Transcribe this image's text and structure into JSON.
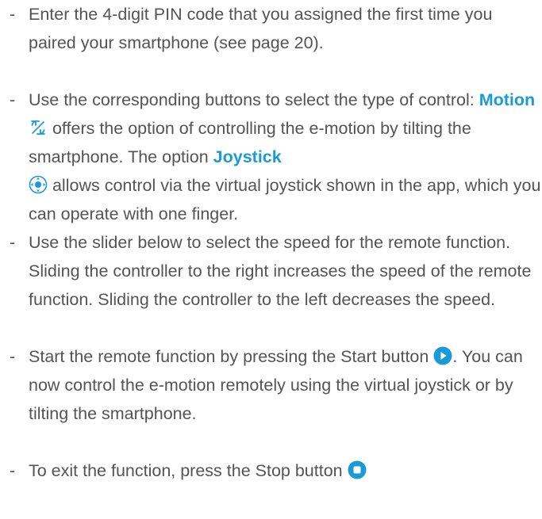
{
  "items": [
    {
      "dash": "-",
      "text": "Enter the 4-digit PIN code that you assigned the first time you paired your smartphone (see page 20)."
    },
    {
      "dash": "-",
      "t1": "Use the corresponding buttons to select the type of control: ",
      "motion_label": "Motion",
      "motion_icon": "rotate-arrows-icon",
      "t2": " offers the option of controlling the e-motion by tilting the smartphone. The option ",
      "joystick_label": "Joystick",
      "joystick_icon": "joystick-icon",
      "t3": " allows control via the virtual joystick shown in the app, which you can operate with one finger."
    },
    {
      "dash": "-",
      "text": "Use the slider below to select the speed for the remote function. Sliding the controller to the right increases the speed of the remote function. Sliding the controller to the left decreases the speed."
    },
    {
      "dash": "-",
      "t1": "Start the remote function by pressing the Start button ",
      "start_icon": "play-button-icon",
      "t2": ". You can now control the e-motion remotely using the virtual joystick or by tilting the smartphone."
    },
    {
      "dash": "-",
      "t1": "To exit the function, press the Stop button ",
      "stop_icon": "stop-button-icon"
    }
  ],
  "colors": {
    "text": "#545454",
    "accent": "#1a9ad6"
  }
}
